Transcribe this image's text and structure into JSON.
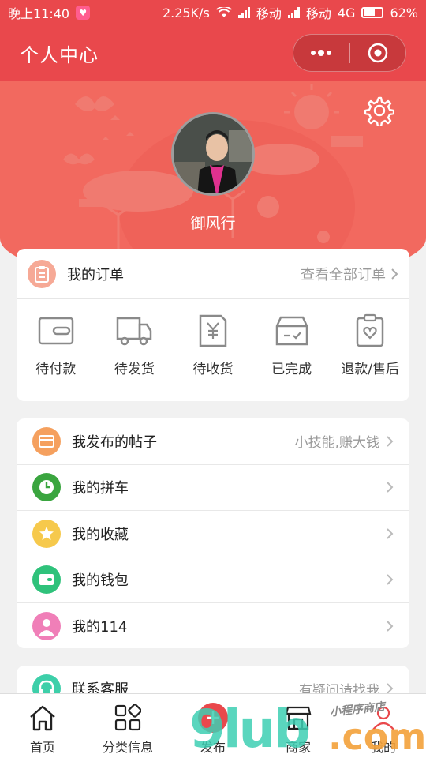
{
  "status_bar": {
    "time": "晚上11:40",
    "speed": "2.25K/s",
    "carrier1": "移动",
    "carrier2": "移动",
    "network": "4G",
    "battery": "62%"
  },
  "header": {
    "title": "个人中心"
  },
  "profile": {
    "username": "御风行"
  },
  "orders": {
    "title": "我的订单",
    "view_all": "查看全部订单",
    "items": [
      {
        "label": "待付款",
        "icon": "wallet-icon"
      },
      {
        "label": "待发货",
        "icon": "truck-icon"
      },
      {
        "label": "待收货",
        "icon": "receipt-icon"
      },
      {
        "label": "已完成",
        "icon": "box-check-icon"
      },
      {
        "label": "退款/售后",
        "icon": "clipboard-heart-icon"
      }
    ]
  },
  "menu": {
    "items": [
      {
        "label": "我发布的帖子",
        "extra": "小技能,赚大钱",
        "icon": "card-icon",
        "color": "#f5a05e"
      },
      {
        "label": "我的拼车",
        "extra": "",
        "icon": "clock-icon",
        "color": "#3aa53f"
      },
      {
        "label": "我的收藏",
        "extra": "",
        "icon": "star-icon",
        "color": "#f6c94c"
      },
      {
        "label": "我的钱包",
        "extra": "",
        "icon": "wallet-icon",
        "color": "#2fc27b"
      },
      {
        "label": "我的114",
        "extra": "",
        "icon": "person-icon",
        "color": "#f07fb8"
      }
    ]
  },
  "contact": {
    "label": "联系客服",
    "extra": "有疑问请找我",
    "icon": "headset-icon",
    "color": "#3dcfa9"
  },
  "tabbar": {
    "items": [
      {
        "label": "首页",
        "icon": "home-icon"
      },
      {
        "label": "分类信息",
        "icon": "grid-icon"
      },
      {
        "label": "发布",
        "icon": "plus-icon"
      },
      {
        "label": "商家",
        "icon": "store-icon"
      },
      {
        "label": "我的",
        "icon": "user-icon"
      }
    ]
  },
  "watermark": {
    "main": "9lub",
    "domain": ".com",
    "tagline": "小程序商店"
  },
  "colors": {
    "primary": "#e9484c",
    "hero": "#f2695f"
  }
}
